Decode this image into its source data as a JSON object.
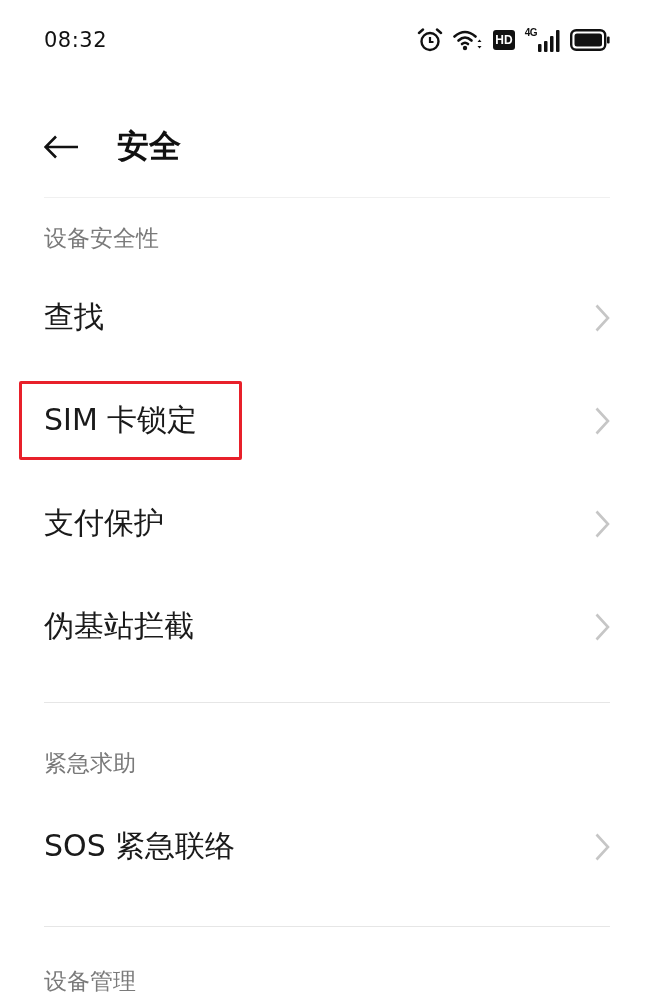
{
  "status_bar": {
    "time": "08:32",
    "hd_badge": "HD",
    "network_type": "4G"
  },
  "header": {
    "title": "安全"
  },
  "sections": [
    {
      "title": "设备安全性",
      "items": [
        {
          "label": "查找",
          "highlighted": false
        },
        {
          "label": "SIM 卡锁定",
          "highlighted": true
        },
        {
          "label": "支付保护",
          "highlighted": false
        },
        {
          "label": "伪基站拦截",
          "highlighted": false
        }
      ]
    },
    {
      "title": "紧急求助",
      "items": [
        {
          "label": "SOS 紧急联络",
          "highlighted": false
        }
      ]
    },
    {
      "title": "设备管理"
    }
  ]
}
